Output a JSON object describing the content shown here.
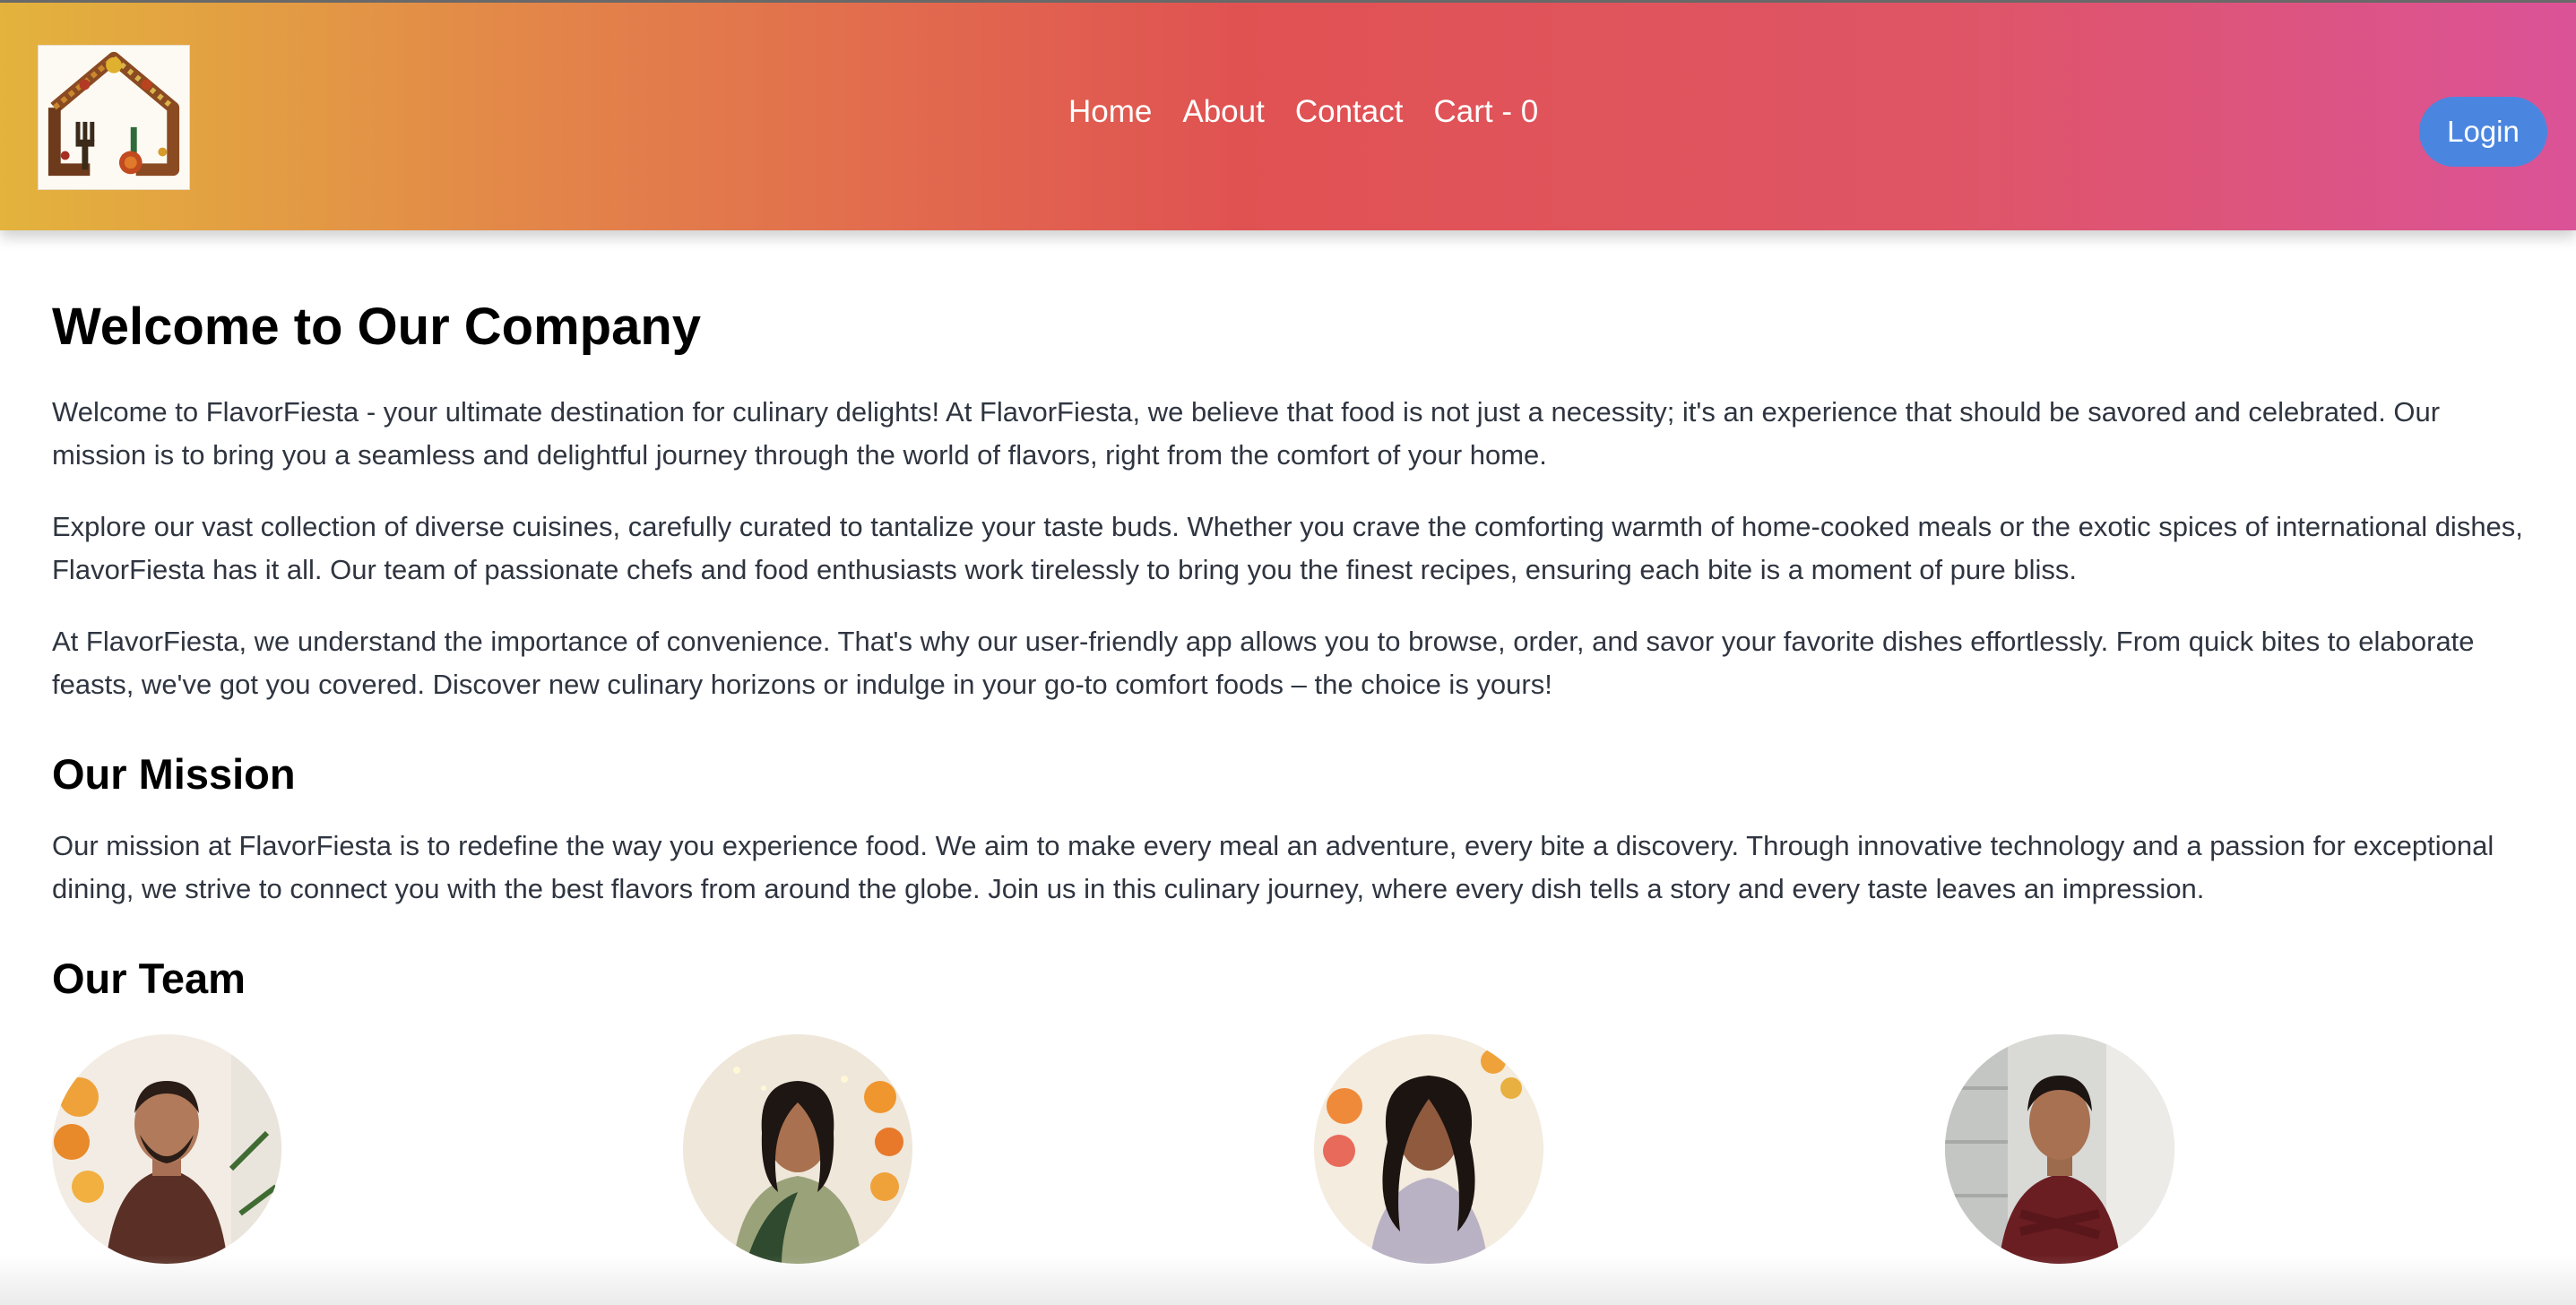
{
  "header": {
    "logo_alt": "FlavorFiesta logo",
    "nav": [
      {
        "label": "Home"
      },
      {
        "label": "About"
      },
      {
        "label": "Contact"
      },
      {
        "label": "Cart - 0"
      }
    ],
    "login_label": "Login"
  },
  "main": {
    "title": "Welcome to Our Company",
    "paragraphs": [
      "Welcome to FlavorFiesta - your ultimate destination for culinary delights! At FlavorFiesta, we believe that food is not just a necessity; it's an experience that should be savored and celebrated. Our mission is to bring you a seamless and delightful journey through the world of flavors, right from the comfort of your home.",
      "Explore our vast collection of diverse cuisines, carefully curated to tantalize your taste buds. Whether you crave the comforting warmth of home-cooked meals or the exotic spices of international dishes, FlavorFiesta has it all. Our team of passionate chefs and food enthusiasts work tirelessly to bring you the finest recipes, ensuring each bite is a moment of pure bliss.",
      "At FlavorFiesta, we understand the importance of convenience. That's why our user-friendly app allows you to browse, order, and savor your favorite dishes effortlessly. From quick bites to elaborate feasts, we've got you covered. Discover new culinary horizons or indulge in your go-to comfort foods – the choice is yours!"
    ],
    "mission_heading": "Our Mission",
    "mission_text": "Our mission at FlavorFiesta is to redefine the way you experience food. We aim to make every meal an adventure, every bite a discovery. Through innovative technology and a passion for exceptional dining, we strive to connect you with the best flavors from around the globe. Join us in this culinary journey, where every dish tells a story and every taste leaves an impression.",
    "team_heading": "Our Team"
  },
  "colors": {
    "gradient_start": "#e3b33d",
    "gradient_mid": "#e05252",
    "gradient_end": "#db5397",
    "login_bg": "#4a86e0"
  }
}
